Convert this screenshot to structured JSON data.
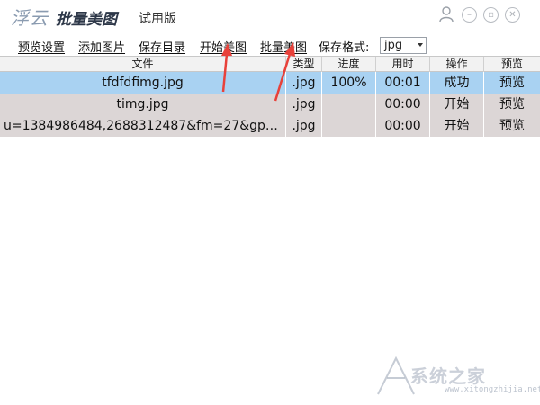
{
  "titlebar": {
    "logo": "浮云",
    "app_name": "批量美图",
    "edition": "试用版"
  },
  "window_controls": [
    "user-icon",
    "minimize-icon",
    "restore-icon",
    "close-icon"
  ],
  "menu": {
    "items": [
      "预览设置",
      "添加图片",
      "保存目录",
      "开始美图",
      "批量美图"
    ],
    "format_label": "保存格式:",
    "format_value": "jpg"
  },
  "table": {
    "headers": [
      "文件",
      "类型",
      "进度",
      "用时",
      "操作",
      "预览"
    ],
    "rows": [
      {
        "file": "tfdfdfimg.jpg",
        "type": ".jpg",
        "progress": "100%",
        "time": "00:01",
        "action": "成功",
        "preview": "预览",
        "selected": true
      },
      {
        "file": "timg.jpg",
        "type": ".jpg",
        "progress": "",
        "time": "00:00",
        "action": "开始",
        "preview": "预览",
        "selected": false
      },
      {
        "file": "u=1384986484,2688312487&fm=27&gp=0.j...",
        "type": ".jpg",
        "progress": "",
        "time": "00:00",
        "action": "开始",
        "preview": "预览",
        "selected": false
      }
    ]
  },
  "annotations": {
    "arrow_color": "#e8413a"
  },
  "watermark": {
    "text": "系统之家",
    "url": "www.xitongzhijia.net"
  },
  "colors": {
    "selected_row": "#a9d2f2",
    "normal_row": "#dcd6d6"
  }
}
